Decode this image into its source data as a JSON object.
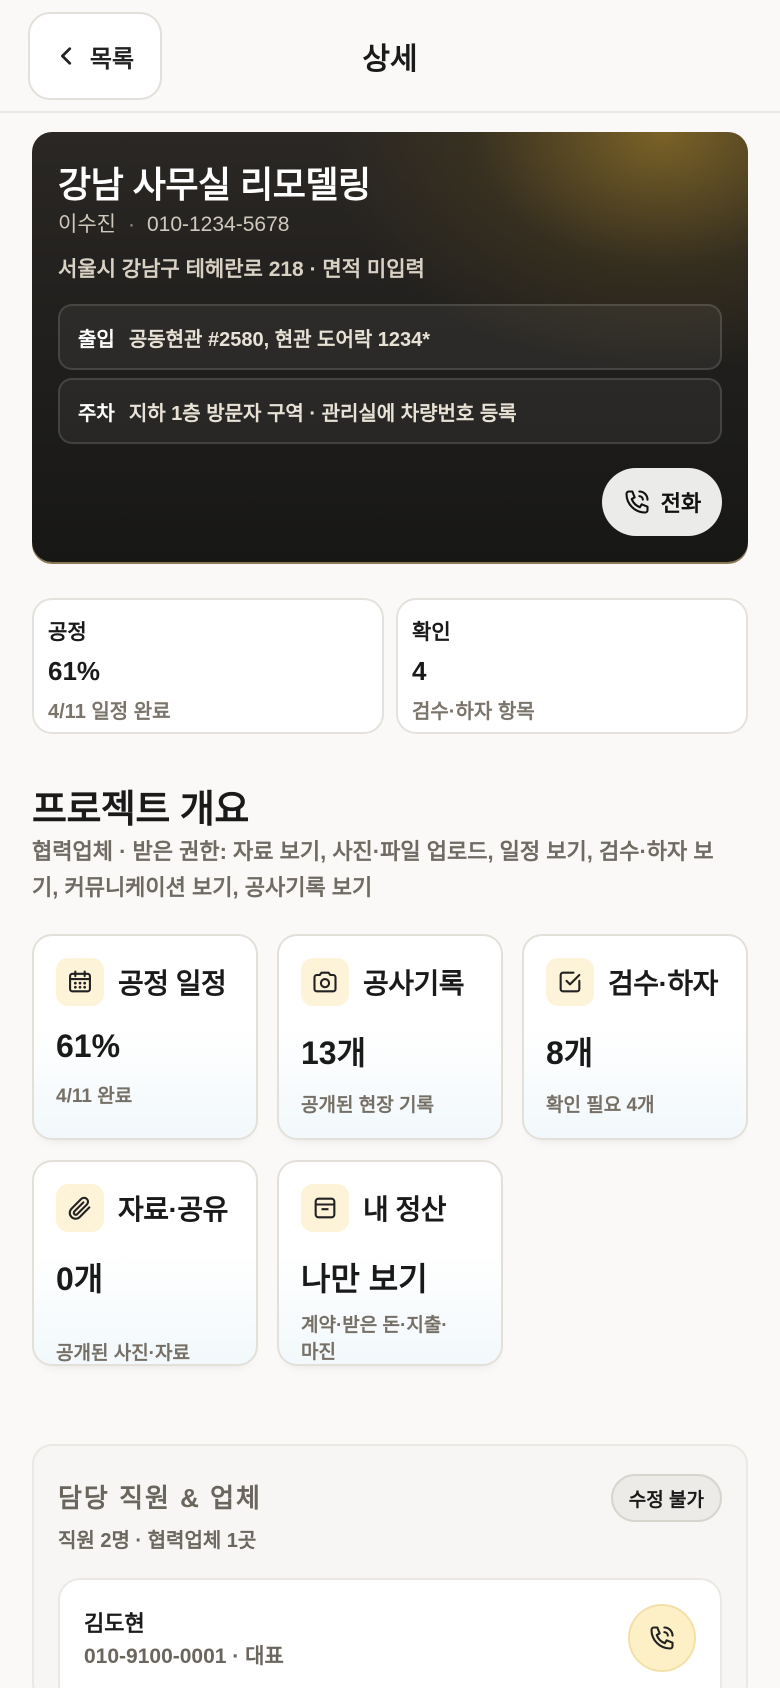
{
  "header": {
    "back_label": "목록",
    "title": "상세"
  },
  "project": {
    "title": "강남 사무실 리모델링",
    "client_name": "이수진",
    "separator": "·",
    "client_phone": "010-1234-5678",
    "address": "서울시 강남구 테헤란로 218 · 면적 미입력",
    "entry_label": "출입",
    "entry_value": "공동현관 #2580, 현관 도어락 1234*",
    "parking_label": "주차",
    "parking_value": "지하 1층 방문자 구역 · 관리실에 차량번호 등록",
    "call_label": "전화"
  },
  "stats": [
    {
      "title": "공정",
      "value": "61%",
      "sub": "4/11 일정 완료"
    },
    {
      "title": "확인",
      "value": "4",
      "sub": "검수·하자 항목"
    }
  ],
  "overview": {
    "title": "프로젝트 개요",
    "description": "협력업체 · 받은 권한: 자료 보기, 사진·파일 업로드, 일정 보기, 검수·하자 보기, 커뮤니케이션 보기, 공사기록 보기"
  },
  "tiles": [
    {
      "name": "공정 일정",
      "icon": "calendar-icon",
      "value": "61%",
      "sub": "4/11 완료"
    },
    {
      "name": "공사기록",
      "icon": "camera-icon",
      "value": "13개",
      "sub": "공개된 현장 기록"
    },
    {
      "name": "검수·하자",
      "icon": "check-square-icon",
      "value": "8개",
      "sub": "확인 필요 4개"
    },
    {
      "name": "자료·공유",
      "icon": "paperclip-icon",
      "value": "0개",
      "sub": "공개된 사진·자료"
    },
    {
      "name": "내 정산",
      "icon": "wallet-icon",
      "value": "나만 보기",
      "sub": "계약·받은 돈·지출·마진"
    }
  ],
  "team": {
    "title": "담당 직원 & 업체",
    "summary": "직원 2명 · 협력업체 1곳",
    "badge": "수정 불가",
    "members": [
      {
        "name": "김도현",
        "detail": "010-9100-0001 · 대표"
      }
    ]
  },
  "colors": {
    "accent_gold": "#fdf3d8",
    "hero_dark": "#171716",
    "muted_text": "#7a746b"
  }
}
